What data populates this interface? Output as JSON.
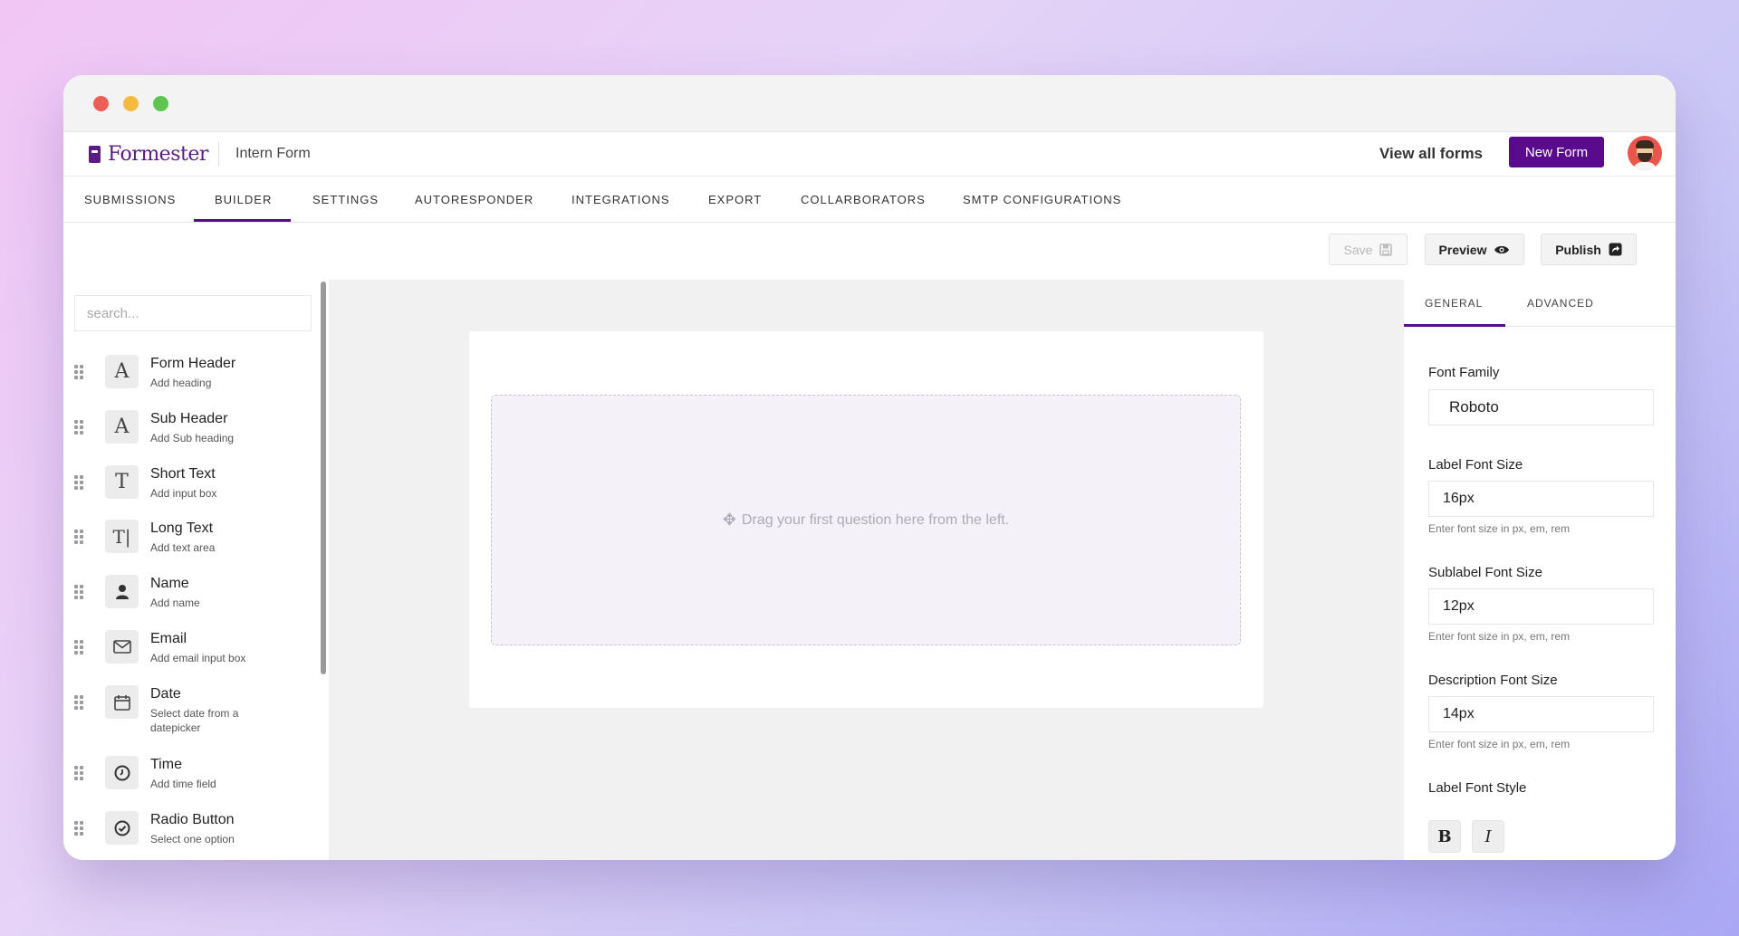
{
  "app": {
    "logo_text": "Formester",
    "form_title": "Intern Form",
    "brand_color": "#5a0b8d"
  },
  "header": {
    "view_all": "View all forms",
    "new_form": "New Form"
  },
  "tabs": [
    {
      "label": "SUBMISSIONS",
      "active": false
    },
    {
      "label": "BUILDER",
      "active": true
    },
    {
      "label": "SETTINGS",
      "active": false
    },
    {
      "label": "AUTORESPONDER",
      "active": false
    },
    {
      "label": "INTEGRATIONS",
      "active": false
    },
    {
      "label": "EXPORT",
      "active": false
    },
    {
      "label": "COLLARBORATORS",
      "active": false
    },
    {
      "label": "SMTP CONFIGURATIONS",
      "active": false
    }
  ],
  "toolbar": {
    "save": "Save",
    "preview": "Preview",
    "publish": "Publish"
  },
  "sidebar": {
    "search_placeholder": "search...",
    "fields": [
      {
        "name": "Form Header",
        "desc": "Add heading",
        "icon": "header-a-icon"
      },
      {
        "name": "Sub Header",
        "desc": "Add Sub heading",
        "icon": "header-a-icon"
      },
      {
        "name": "Short Text",
        "desc": "Add input box",
        "icon": "text-t-icon"
      },
      {
        "name": "Long Text",
        "desc": "Add text area",
        "icon": "text-cursor-icon"
      },
      {
        "name": "Name",
        "desc": "Add name",
        "icon": "user-icon"
      },
      {
        "name": "Email",
        "desc": "Add email input box",
        "icon": "envelope-icon"
      },
      {
        "name": "Date",
        "desc": "Select date from a datepicker",
        "icon": "calendar-icon"
      },
      {
        "name": "Time",
        "desc": "Add time field",
        "icon": "clock-icon"
      },
      {
        "name": "Radio Button",
        "desc": "Select one option",
        "icon": "check-circle-icon"
      }
    ]
  },
  "canvas": {
    "dropzone_text": "Drag your first question here from the left."
  },
  "panel": {
    "tabs": [
      "GENERAL",
      "ADVANCED"
    ],
    "font_family_label": "Font Family",
    "font_family_value": "Roboto",
    "label_font_size_label": "Label Font Size",
    "label_font_size_value": "16px",
    "sublabel_font_size_label": "Sublabel Font Size",
    "sublabel_font_size_value": "12px",
    "description_font_size_label": "Description Font Size",
    "description_font_size_value": "14px",
    "help_text": "Enter font size in px, em, rem",
    "label_font_style_label": "Label Font Style",
    "bold": "B",
    "italic": "I"
  }
}
